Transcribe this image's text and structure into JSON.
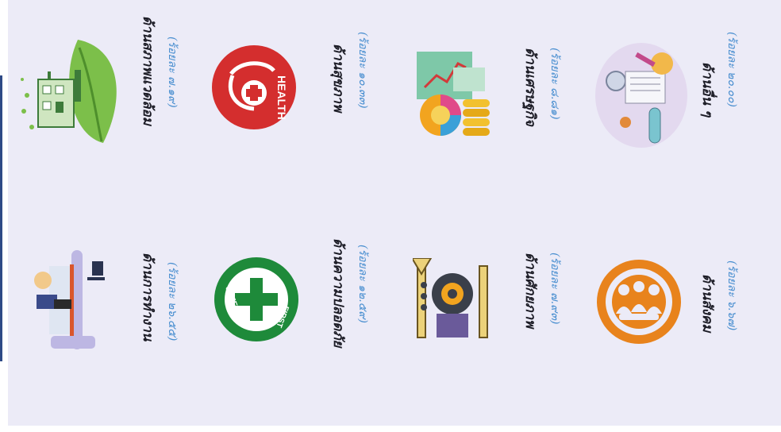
{
  "categories": [
    {
      "id": "environment",
      "title": "ด้านสภาพแวดล้อม",
      "percent": "(ร้อยละ ๗.๑๙)",
      "icon": "house-leaf-icon"
    },
    {
      "id": "work",
      "title": "ด้านการทำงาน",
      "percent": "(ร้อยละ ๒๖.๕๕)",
      "icon": "office-worker-icon"
    },
    {
      "id": "health",
      "title": "ด้านสุขภาพ",
      "percent": "(ร้อยละ ๑๐.๓๓)",
      "icon": "health-stethoscope-icon",
      "badge_text": "HEALTH"
    },
    {
      "id": "safety",
      "title": "ด้านความปลอดภัย",
      "percent": "(ร้อยละ ๑๒.๕๙)",
      "icon": "safety-first-icon",
      "badge_text_top": "SAFETY",
      "badge_text_bottom": "FIRST"
    },
    {
      "id": "economy",
      "title": "ด้านเศรษฐกิจ",
      "percent": "(ร้อยละ ๘.๘๑)",
      "icon": "money-chart-icon"
    },
    {
      "id": "potential",
      "title": "ด้านศักยภาพ",
      "percent": "(ร้อยละ ๗.๙๓)",
      "icon": "gear-head-icon"
    },
    {
      "id": "other",
      "title": "ด้านอื่น ๆ",
      "percent": "(ร้อยละ ๒๐.๐๐)",
      "icon": "science-tools-icon"
    },
    {
      "id": "social",
      "title": "ด้านสังคม",
      "percent": "(ร้อยละ ๖.๖๗)",
      "icon": "people-group-icon"
    }
  ],
  "colors": {
    "background": "#ecebf7",
    "label": "#1c1c26",
    "percent": "#4a8fd0",
    "health_red": "#d42e2e",
    "safety_green": "#1e8a3a",
    "social_orange": "#e8831c",
    "accent_bar": "#2e4a86"
  }
}
